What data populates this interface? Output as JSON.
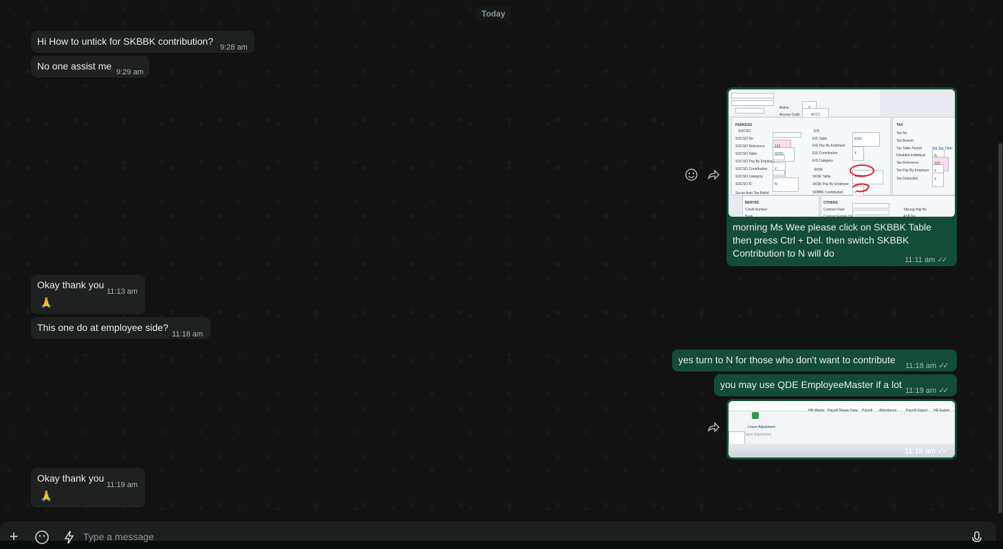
{
  "date_divider": "Today",
  "messages": [
    {
      "id": "m1",
      "dir": "in",
      "text": "Hi How to untick for SKBBK contribution?",
      "time": "9:28 am"
    },
    {
      "id": "m2",
      "dir": "in",
      "text": "No one assist me",
      "time": "9:29 am"
    },
    {
      "id": "m3",
      "dir": "out",
      "caption_lines": [
        "morning Ms Wee please click on SKBBK Table",
        "then press Ctrl + Del. then switch SKBBK",
        "Contribution to N will do"
      ],
      "time": "11:11 am"
    },
    {
      "id": "m4",
      "dir": "in",
      "text": "Okay thank you",
      "emoji": "🙏",
      "time": "11:13 am"
    },
    {
      "id": "m5",
      "dir": "in",
      "text": "This one do at employee side?",
      "time": "11:18 am"
    },
    {
      "id": "m6",
      "dir": "out",
      "text": "yes turn to N for those who don't want to contribute",
      "time": "11:18 am"
    },
    {
      "id": "m7",
      "dir": "out",
      "text": "you may use QDE EmployeeMaster if a lot",
      "time": "11:19 am"
    },
    {
      "id": "m8",
      "dir": "out",
      "image": true,
      "time": "11:19 am"
    },
    {
      "id": "m9",
      "dir": "in",
      "text": "Okay thank you",
      "emoji": "🙏",
      "time": "11:19 am"
    }
  ],
  "screenshot1": {
    "header_labels": [
      "Active",
      "Access Code"
    ],
    "header_values": [
      "Y",
      "ACC1"
    ],
    "perkeso": {
      "title": "PERKESO",
      "sub": "SOCSO",
      "fields": [
        "SOCSO No",
        "SOCSO Reference",
        "SOCSO Table",
        "SOCSO Pay By Employer",
        "SOCSO Contribution",
        "SOCSO Category",
        "SOCSO IC"
      ],
      "values": [
        "",
        "123",
        "SOS1",
        "",
        "Y",
        "",
        "N"
      ]
    },
    "eis": {
      "title": "EIS",
      "fields": [
        "EIS Table",
        "EIS Pay By Employer",
        "EIS Contribution",
        "EIS Category"
      ],
      "values": [
        "EIS1",
        "",
        "Y",
        ""
      ]
    },
    "sksk": {
      "title": "SKSK",
      "fields": [
        "SKSK Table",
        "SKSK Pay By Employer",
        "SKBBK Contribution"
      ],
      "values": [
        "SKBK1",
        "",
        "Y"
      ]
    },
    "tax": {
      "title": "TAX",
      "fields": [
        "Tax No",
        "Tax Branch",
        "Tax Table Period",
        "Disabled Individual",
        "Tax Reference",
        "Tax Pay By Employer",
        "Tax Deduction"
      ],
      "values": [
        "",
        "",
        "Set Tax Table",
        "N",
        "123",
        "Y",
        "Y"
      ]
    },
    "checkbox": "Socso Auto Tax Relief",
    "bottom_sections": [
      "BERTAS",
      "OTHERS"
    ],
    "bottom_fields": [
      "Credit Number",
      "Bank",
      "Contract Date",
      "Contract Expire On",
      "Tabung Haji No",
      "ASB No"
    ]
  },
  "screenshot2": {
    "menu": [
      "HR Master",
      "Payroll Master",
      "Data",
      "Payroll",
      "Attendance",
      "Payroll Export",
      "HR Export"
    ],
    "button": "Leave Adjustment",
    "sub": "Leave Adjustment"
  },
  "composer": {
    "placeholder": "Type a message"
  },
  "icons": {
    "emoji_react": "smiley-icon",
    "forward": "forward-icon",
    "attach": "plus-icon",
    "sticker": "sticker-icon",
    "quick": "lightning-icon",
    "mic": "mic-icon"
  },
  "colors": {
    "incoming": "#1f2020",
    "outgoing": "#144d37",
    "background": "#121212"
  }
}
